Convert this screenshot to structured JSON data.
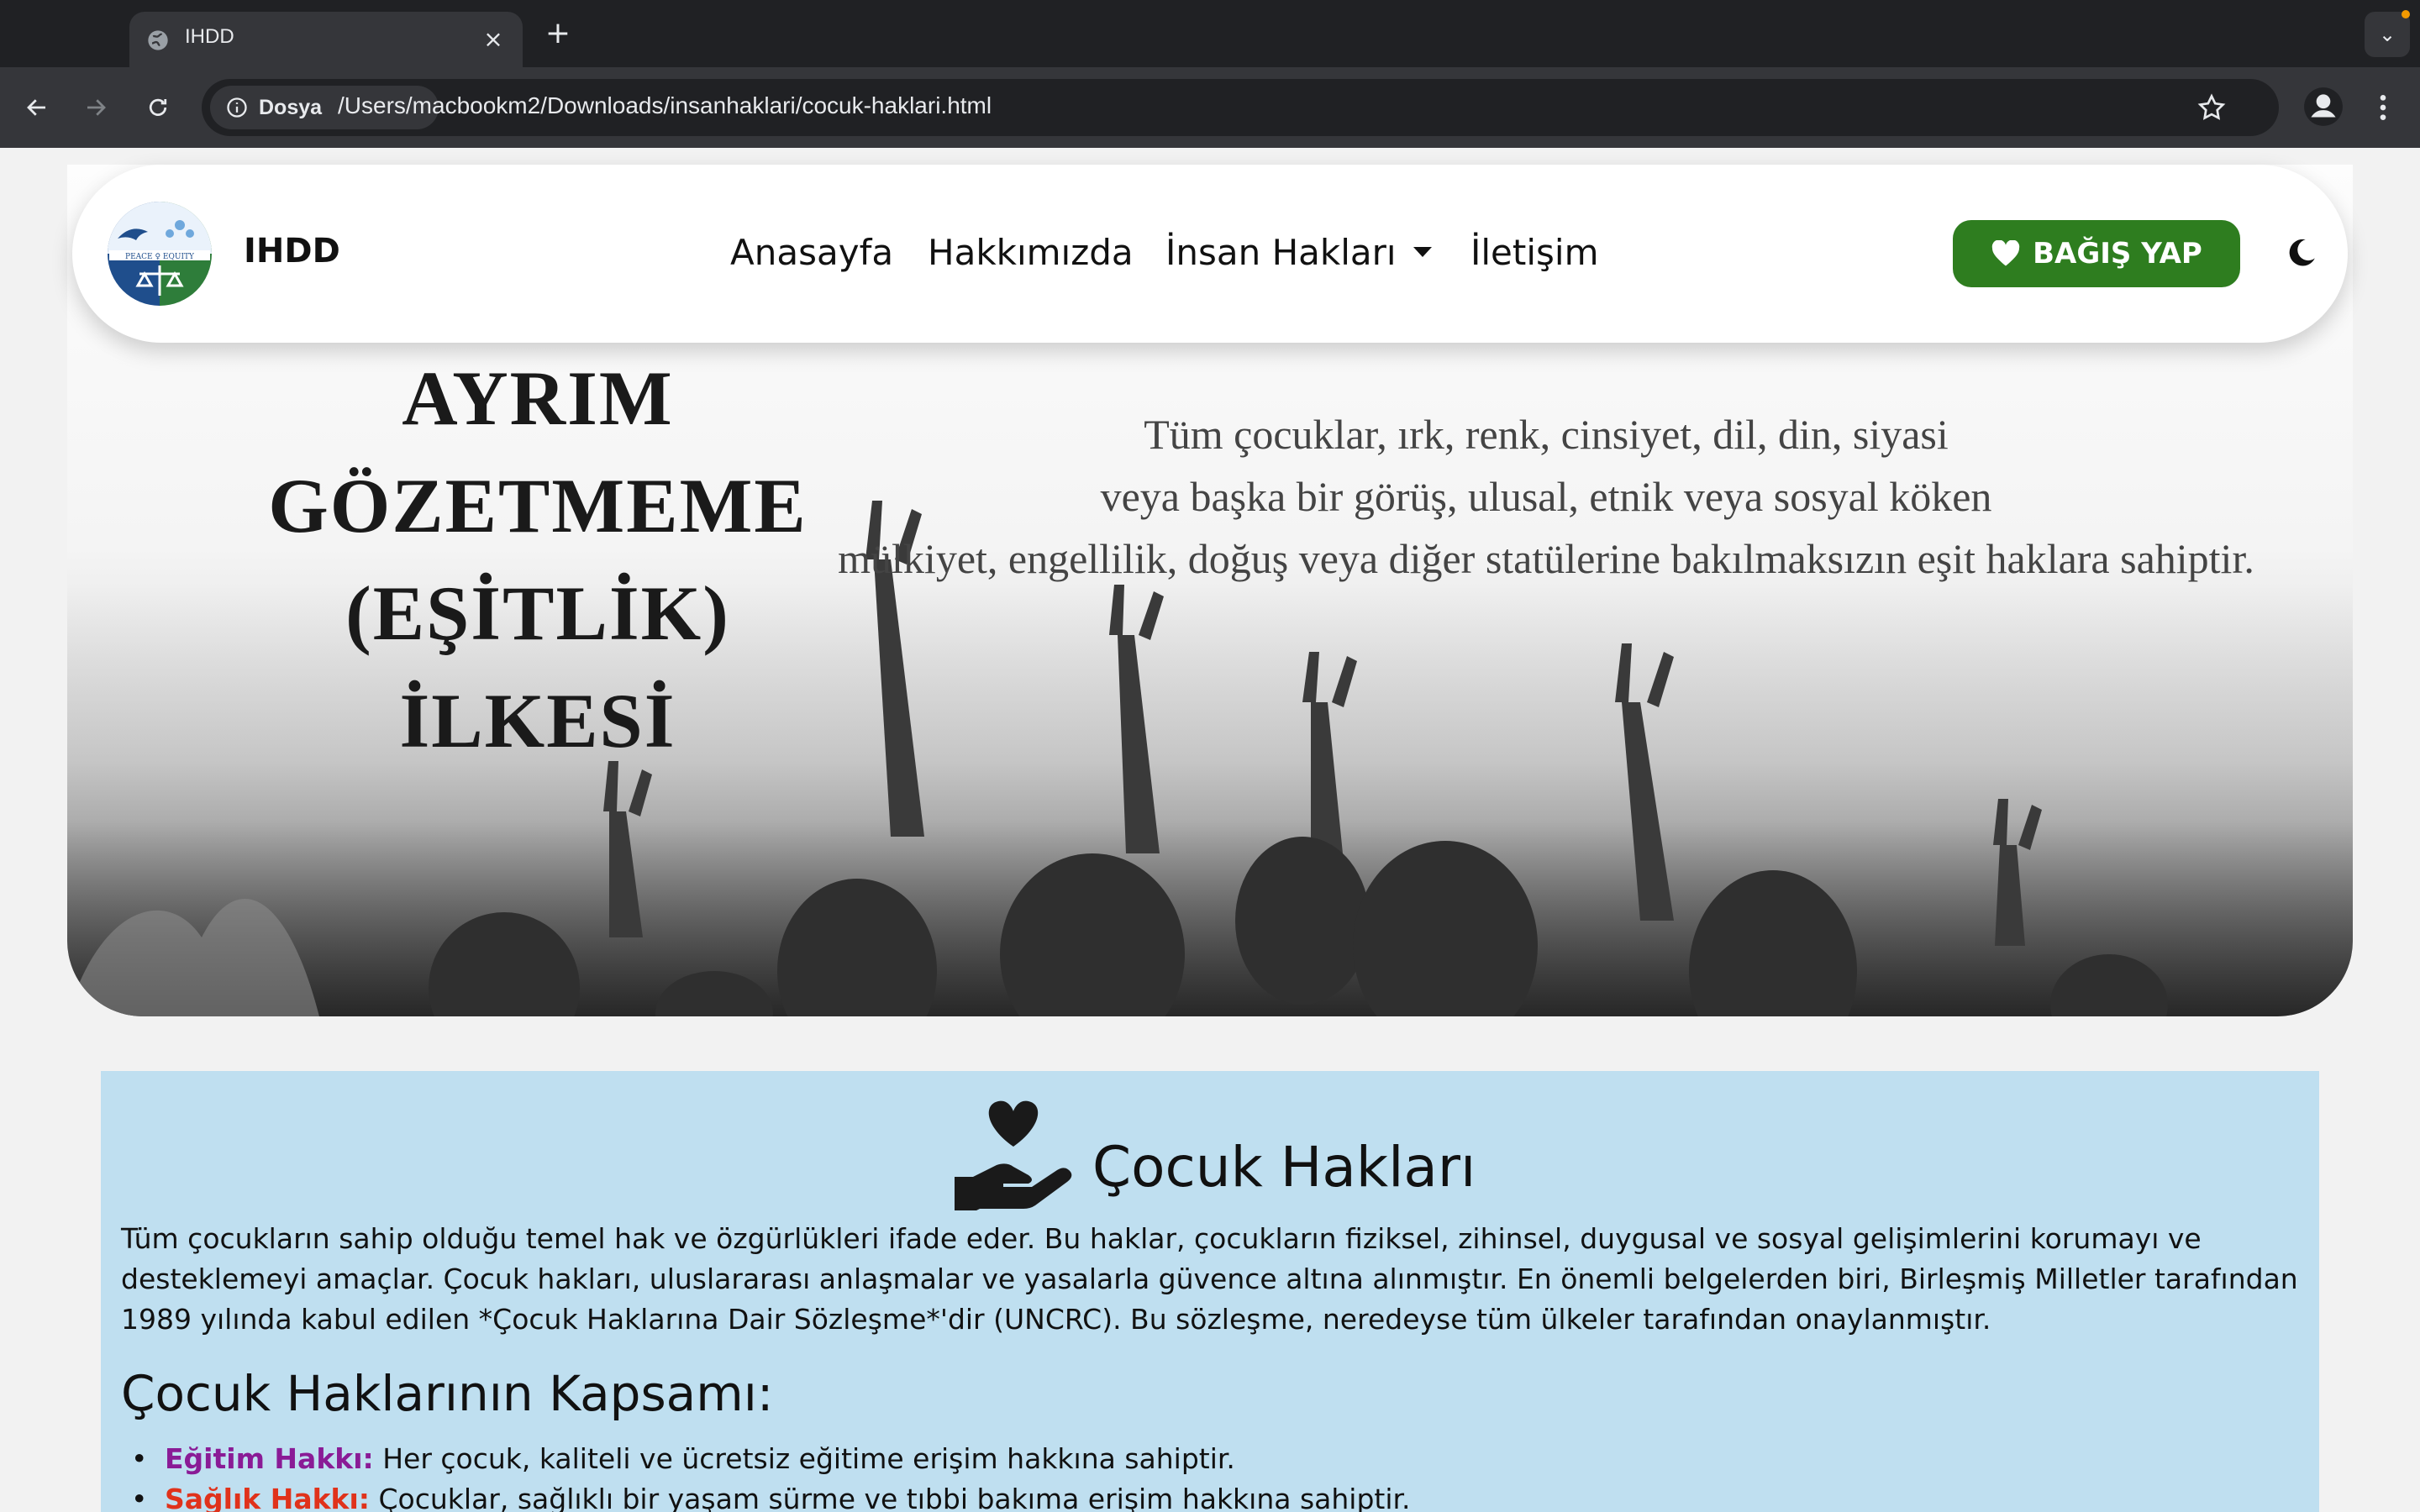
{
  "browser": {
    "tab_title": "IHDD",
    "site_chip": "Dosya",
    "url": "/Users/macbookm2/Downloads/insanhaklari/cocuk-haklari.html"
  },
  "navbar": {
    "brand": "IHDD",
    "links": [
      "Anasayfa",
      "Hakkımızda",
      "İnsan Hakları",
      "İletişim"
    ],
    "donate_label": "BAĞIŞ YAP",
    "accent_color": "#2e7d1f"
  },
  "hero": {
    "title_lines": [
      "AYRIM GÖZETMEME",
      "(EŞİTLİK)",
      "İLKESİ"
    ],
    "text_lines": [
      "Tüm çocuklar, ırk, renk, cinsiyet, dil, din, siyasi",
      "veya başka bir görüş, ulusal, etnik veya sosyal köken",
      "mülkiyet, engellilik, doğuş veya diğer statülerine bakılmaksızın eşit haklara sahiptir."
    ]
  },
  "content": {
    "background": "#bfdff0",
    "title": "Çocuk Hakları",
    "intro": "Tüm çocukların sahip olduğu temel hak ve özgürlükleri ifade eder. Bu haklar, çocukların fiziksel, zihinsel, duygusal ve sosyal gelişimlerini korumayı ve desteklemeyi amaçlar. Çocuk hakları, uluslararası anlaşmalar ve yasalarla güvence altına alınmıştır. En önemli belgelerden biri, Birleşmiş Milletler tarafından 1989 yılında kabul edilen *Çocuk Haklarına Dair Sözleşme*'dir (UNCRC). Bu sözleşme, neredeyse tüm ülkeler tarafından onaylanmıştır.",
    "subtitle": "Çocuk Haklarının Kapsamı:",
    "rights": [
      {
        "label": "Eğitim Hakkı:",
        "text": " Her çocuk, kaliteli ve ücretsiz eğitime erişim hakkına sahiptir.",
        "color": "#8a1b96"
      },
      {
        "label": "Sağlık Hakkı:",
        "text": " Çocuklar, sağlıklı bir yaşam sürme ve tıbbi bakıma erişim hakkına sahiptir.",
        "color": "#e0321b"
      }
    ]
  }
}
